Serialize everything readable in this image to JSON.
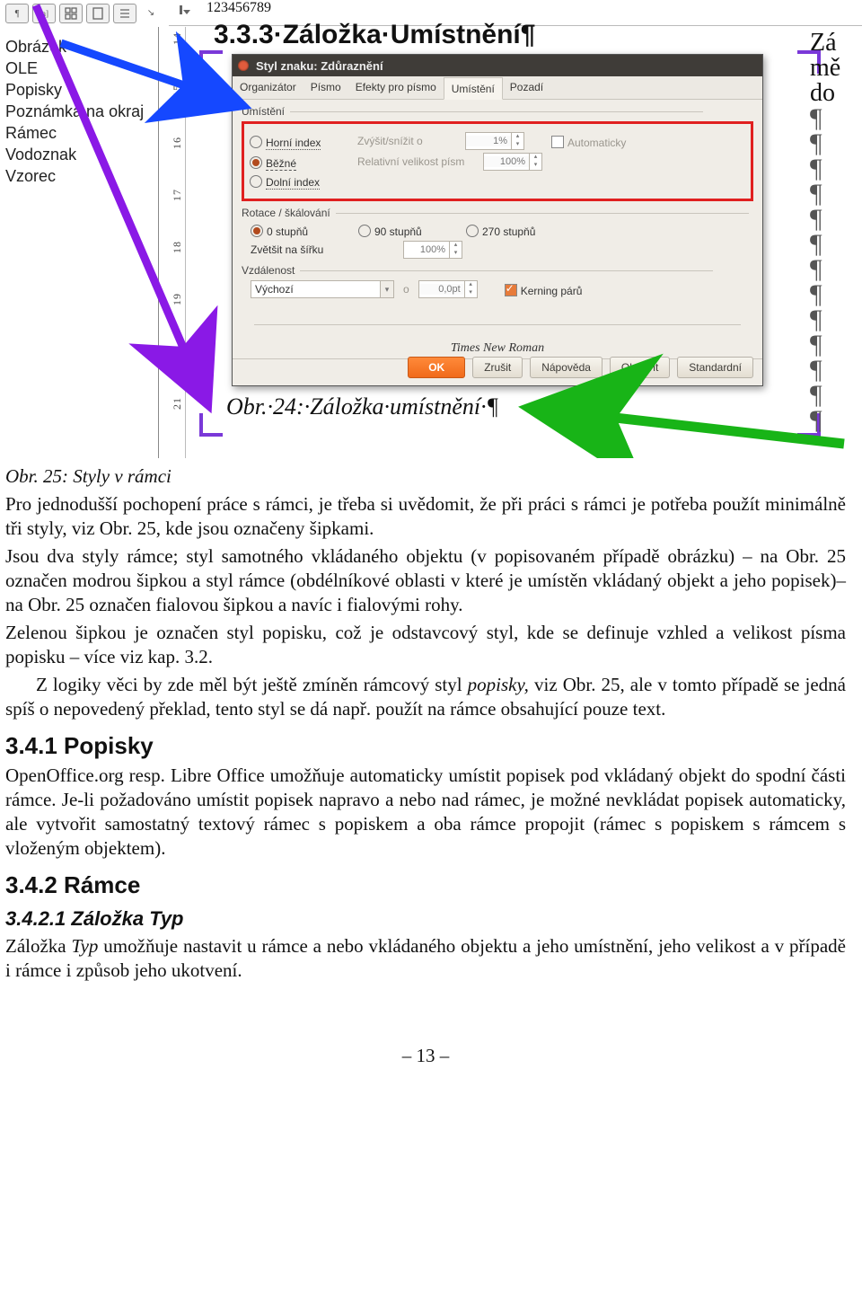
{
  "toolbar_icons": [
    "pilcrow",
    "bracket-a",
    "grid",
    "page",
    "list",
    "arrow"
  ],
  "styles_panel": {
    "items": [
      "Obrázek",
      "OLE",
      "Popisky",
      "Poznámka na okraj",
      "Rámec",
      "Vodoznak",
      "Vzorec"
    ]
  },
  "hruler": {
    "marks": [
      1,
      2,
      3,
      4,
      5,
      6,
      7,
      8,
      9
    ]
  },
  "vruler": {
    "marks": [
      14,
      15,
      16,
      17,
      18,
      19,
      20,
      21
    ]
  },
  "heading": "3.3.3·Záložka·Umístnění¶",
  "dialog": {
    "title": "Styl znaku: Zdůraznění",
    "tabs": [
      "Organizátor",
      "Písmo",
      "Efekty pro písmo",
      "Umístění",
      "Pozadí"
    ],
    "active_tab": "Umístění",
    "group_pos": {
      "title": "Umístění",
      "opts": [
        "Horní index",
        "Běžné",
        "Dolní index"
      ],
      "raise_label": "Zvýšit/snížit o",
      "raise_val": "1%",
      "auto": "Automaticky",
      "rel_label": "Relativní velikost písm",
      "rel_val": "100%"
    },
    "group_rot": {
      "title": "Rotace / škálování",
      "opts": [
        "0 stupňů",
        "90 stupňů",
        "270 stupňů"
      ],
      "scale_label": "Zvětšit na šířku",
      "scale_val": "100%"
    },
    "group_spc": {
      "title": "Vzdálenost",
      "sel": "Výchozí",
      "by_label": "o",
      "by_val": "0,0pt",
      "kern": "Kerning párů"
    },
    "sample": "Times New Roman",
    "buttons": {
      "ok": "OK",
      "cancel": "Zrušit",
      "help": "Nápověda",
      "reset": "Obnovit",
      "std": "Standardní"
    }
  },
  "caption_in_figure": "Obr.·24:·Záložka·umístnění·¶",
  "side": {
    "t1": "Zá",
    "t2": "mě",
    "t3": "do",
    "pil": "¶"
  },
  "body": {
    "cap25": "Obr. 25: Styly v rámci",
    "p1": "Pro jednodušší pochopení práce s rámci, je třeba si uvědomit, že při práci s rámci je potřeba použít minimálně tři styly, viz Obr. 25, kde jsou označeny šipkami.",
    "p2": "Jsou dva styly rámce; styl samotného vkládaného objektu (v popisovaném případě obrázku) – na Obr. 25 označen modrou šipkou a styl rámce (obdélníkové oblasti v které je umístěn vkládaný objekt a jeho popisek)– na Obr. 25 označen fialovou šipkou a navíc i fialovými rohy.",
    "p3a": "Zelenou šipkou je označen styl popisku, což je odstavcový styl, kde se definuje vzhled a velikost písma popisku – více viz kap. 3.2.",
    "p3b_a": "Z logiky věci by zde měl být ještě zmíněn rámcový styl ",
    "p3b_i": "popisky,",
    "p3b_b": " viz Obr. 25, ale v tomto případě se jedná spíš o nepovedený překlad, tento styl se dá např. použít na rámce obsahující pouze text.",
    "h341": "3.4.1 Popisky",
    "p4": "OpenOffice.org resp. Libre Office umožňuje automaticky umístit popisek pod vkládaný objekt do spodní části rámce. Je-li požadováno umístit popisek napravo a nebo nad rámec, je možné nevkládat popisek automaticky, ale vytvořit samostatný textový rámec s popiskem a oba rámce propojit (rámec s popiskem s rámcem s vloženým objektem).",
    "h342": "3.4.2 Rámce",
    "h3421": "3.4.2.1  Záložka Typ",
    "p5a": "Záložka ",
    "p5i": "Typ",
    "p5b": " umožňuje nastavit u rámce a nebo vkládaného objektu a jeho umístnění, jeho velikost a v případě i rámce i způsob jeho ukotvení.",
    "pagenum": "– 13 –"
  }
}
